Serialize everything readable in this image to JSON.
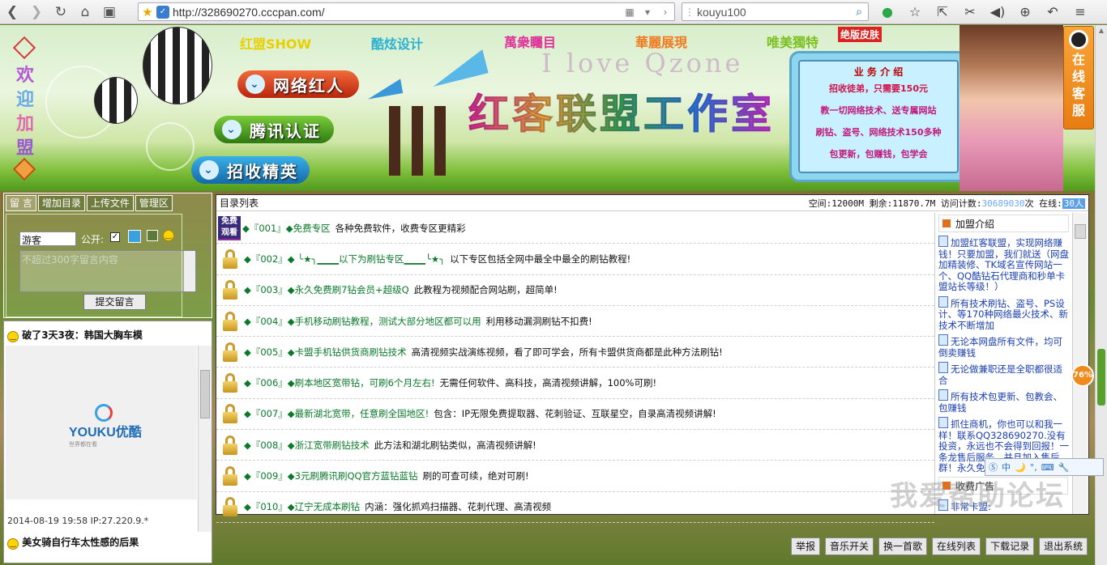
{
  "browser": {
    "url": "http://328690270.cccpan.com/",
    "search_query": "kouyu100"
  },
  "banner": {
    "welcome": [
      "欢",
      "迎",
      "加",
      "盟"
    ],
    "tags": [
      "红盟SHOW",
      "酷炫设计",
      "萬衆矚目",
      "華麗展現",
      "唯美獨特"
    ],
    "skin_label": "绝版皮肤",
    "pills": [
      "网络红人",
      "腾讯认证",
      "招收精英"
    ],
    "ilove": "I love Qzone",
    "logo": "红客联盟工作室",
    "ad": {
      "title": "业 务 介 绍",
      "lines": [
        "招收徒弟，只需要150元",
        "教一切网络技术、送专属网站",
        "刷钻、盗号、网络技术150多种",
        "包更新，包赚钱，包学会"
      ]
    },
    "kefu": "在线客服"
  },
  "left": {
    "tabs": [
      "留 言",
      "增加目录",
      "上传文件",
      "管理区"
    ],
    "name_value": "游客",
    "public_label": "公开:",
    "textarea_placeholder": "不超过300字留言内容",
    "submit_label": "提交留言",
    "msg1": "破了3天3夜：韩国大胸车模",
    "youku": "YOUKU优酷",
    "youku_sub": "世界都在看",
    "meta": "2014-08-19 19:58 IP:27.220.9.*",
    "msg2": "美女骑自行车太性感的后果"
  },
  "main": {
    "header": "目录列表",
    "space_label": "空间:12000M 剩余:11870.7M 访问计数:",
    "visits": "30689030",
    "online_label": "次 在线:",
    "online": "30人",
    "free_badge": [
      "免费",
      "观看"
    ],
    "rows": [
      {
        "num": "◆『001』◆免费专区",
        "desc": "各种免费软件，收费专区更精彩"
      },
      {
        "num": "◆『002』◆ ╰★╮▁▁▁以下为刷钻专区▁▁▁╰★╮",
        "desc": "以下专区包括全网中最全中最全的刷钻教程!"
      },
      {
        "num": "◆『003』◆永久免费刷7钻会员+超级Q",
        "desc": "此教程为视频配合网站刷，超简单!"
      },
      {
        "num": "◆『004』◆手机移动刷钻教程，测试大部分地区都可以用",
        "desc": "利用移动漏洞刷钻不扣费!"
      },
      {
        "num": "◆『005』◆卡盟手机钻供货商刷钻技术",
        "desc": "高清视频实战演练视频，看了即可学会，所有卡盟供货商都是此种方法刷钻!"
      },
      {
        "num": "◆『006』◆刷本地区宽带钻，可刷6个月左右!",
        "desc": "无需任何软件、高科技，高清视频讲解，100%可刷!"
      },
      {
        "num": "◆『007』◆最新湖北宽带，任意刷全国地区!",
        "desc": "包含：IP无限免费提取器、花刺验证、互联星空，自录高清视频讲解!"
      },
      {
        "num": "◆『008』◆浙江宽带刷钻技术",
        "desc": "此方法和湖北刷钻类似，高清视频讲解!"
      },
      {
        "num": "◆『009』◆3元刷腾讯刷QQ官方蓝钻蓝钻",
        "desc": "刷的可查可续，绝对可刷!"
      },
      {
        "num": "◆『010』◆辽宁无成本刷钻",
        "desc": "内涵：强化抓鸡扫描器、花刺代理、高清视频"
      }
    ],
    "side_title": "加盟介绍",
    "side_items": [
      "加盟红客联盟，实现网络赚钱！只要加盟，我们就送（网盘加精装修、TK域名宣传网站一个、QQ酷钻石代理商和秒单卡盟站长等级！）",
      "所有技术刷钻、盗号、PS设计、等170种网络最火技术、新技术不断增加",
      "无论本网盘所有文件，均可倒卖赚钱",
      "无论做兼职还是全职都很适合",
      "所有技术包更新、包教会、包赚钱",
      "抓住商机，你也可以和我一样！联系QQ328690270.没有投资，永远也不会得到回报！一条龙售后服务，并且加入售后群！永久免费"
    ],
    "side_title2": "收费广告",
    "side_item2": "非常卡盟:"
  },
  "ime": [
    "中",
    "🌙",
    "°,",
    "⌨",
    "🔧"
  ],
  "percent": "76%",
  "watermark": "我爱帮助论坛",
  "bottom": [
    "举报",
    "音乐开关",
    "换一首歌",
    "在线列表",
    "下载记录",
    "退出系统"
  ]
}
